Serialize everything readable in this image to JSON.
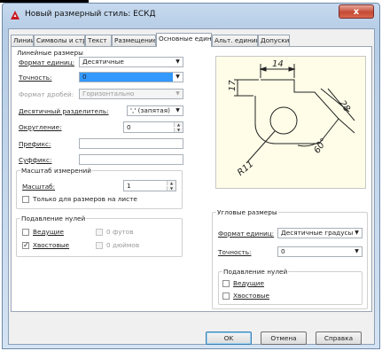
{
  "window": {
    "title": "Новый размерный стиль: ЕСКД",
    "close_label": "x"
  },
  "tabs": [
    "Линии",
    "Символы и стрелки",
    "Текст",
    "Размещение",
    "Основные единицы",
    "Альт. единицы",
    "Допуски"
  ],
  "active_tab_index": 4,
  "linear": {
    "group_title": "Линейные размеры",
    "unit_format_label": "Формат единиц:",
    "unit_format_value": "Десятичные",
    "precision_label": "Точность:",
    "precision_value": "0",
    "fraction_format_label": "Формат дробей:",
    "fraction_format_value": "Горизонтально",
    "decimal_separator_label": "Десятичный разделитель:",
    "decimal_separator_value": "',' (запятая)",
    "round_off_label": "Округление:",
    "round_off_value": "0",
    "prefix_label": "Префикс:",
    "prefix_value": "",
    "suffix_label": "Суффикс:",
    "suffix_value": ""
  },
  "scale": {
    "group_title": "Масштаб измерений",
    "factor_label": "Масштаб:",
    "factor_value": "1",
    "layout_only_label": "Только для размеров на листе",
    "layout_only_checked": false
  },
  "zero_suppression_linear": {
    "group_title": "Подавление нулей",
    "leading_label": "Ведущие",
    "leading_checked": false,
    "trailing_label": "Хвостовые",
    "trailing_checked": true,
    "feet_label": "0 футов",
    "inches_label": "0 дюймов"
  },
  "preview": {
    "dim_14": "14",
    "dim_17": "17",
    "dim_28": "28",
    "dim_60": "60°",
    "dim_r11": "R11"
  },
  "angular": {
    "group_title": "Угловые размеры",
    "unit_format_label": "Формат единиц:",
    "unit_format_value": "Десятичные градусы",
    "precision_label": "Точность:",
    "precision_value": "0",
    "zero_group_title": "Подавление нулей",
    "leading_label": "Ведущие",
    "trailing_label": "Хвостовые"
  },
  "buttons": {
    "ok": "OK",
    "cancel": "Отмена",
    "help": "Справка"
  },
  "colors": {
    "accent": "#3399ff",
    "titlebar": "#c6d9ee",
    "close": "#c44a35"
  }
}
